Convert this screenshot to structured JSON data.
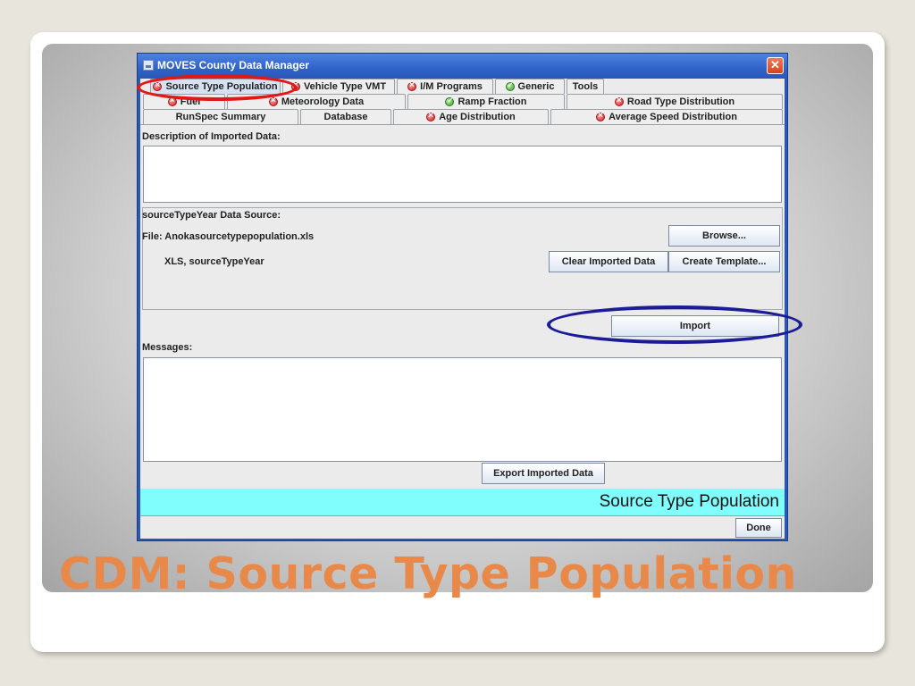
{
  "window": {
    "title": "MOVES County Data Manager",
    "close_glyph": "✕"
  },
  "tabs": {
    "row1": [
      {
        "label": "Source Type Population",
        "status": "error"
      },
      {
        "label": "Vehicle Type VMT",
        "status": "error"
      },
      {
        "label": "I/M Programs",
        "status": "error"
      },
      {
        "label": "Generic",
        "status": "ok"
      },
      {
        "label": "Tools",
        "status": "none"
      }
    ],
    "row2": [
      {
        "label": "Fuel",
        "status": "error"
      },
      {
        "label": "Meteorology Data",
        "status": "error"
      },
      {
        "label": "Ramp Fraction",
        "status": "ok"
      },
      {
        "label": "Road Type Distribution",
        "status": "error"
      }
    ],
    "row3": [
      {
        "label": "RunSpec Summary",
        "status": "none"
      },
      {
        "label": "Database",
        "status": "none"
      },
      {
        "label": "Age Distribution",
        "status": "error"
      },
      {
        "label": "Average Speed Distribution",
        "status": "error"
      }
    ]
  },
  "description": {
    "label": "Description of Imported Data:",
    "value": ""
  },
  "source": {
    "label": "sourceTypeYear Data Source:",
    "file_text": "File: Anokasourcetypepopulation.xls",
    "format_text": "XLS, sourceTypeYear",
    "browse_label": "Browse...",
    "clear_label": "Clear Imported Data",
    "template_label": "Create Template..."
  },
  "import_label": "Import",
  "messages": {
    "label": "Messages:",
    "value": ""
  },
  "export_label": "Export Imported Data",
  "banner_text": "Source Type Population",
  "done_label": "Done",
  "slide": {
    "title": "CDM: Source Type Population",
    "title_color": "#e8894a"
  },
  "colors": {
    "highlight_oval_red": "#e01818",
    "highlight_oval_blue": "#1c1c9a",
    "banner": "#80fefe"
  }
}
